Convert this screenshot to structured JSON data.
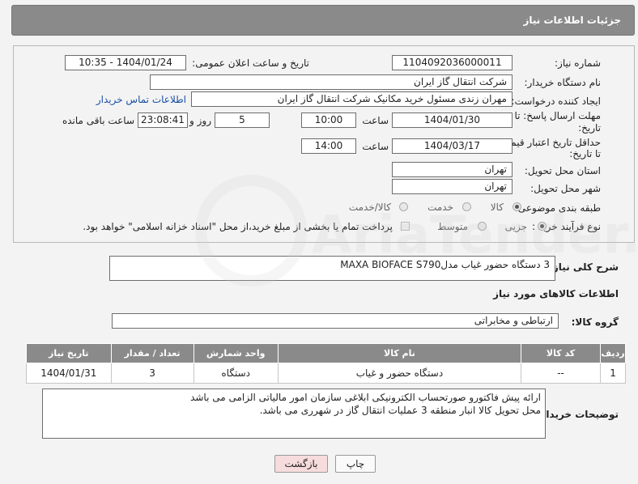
{
  "header": {
    "title": "جزئیات اطلاعات نیاز"
  },
  "form": {
    "need_number_label": "شماره نیاز:",
    "need_number": "1104092036000011",
    "announce_label": "تاریخ و ساعت اعلان عمومی:",
    "announce_value": "1404/01/24 - 10:35",
    "buyer_org_label": "نام دستگاه خریدار:",
    "buyer_org": "شرکت انتقال گاز ایران",
    "creator_label": "ایجاد کننده درخواست:",
    "creator": "مهران زندی مسئول خرید مکانیک شرکت انتقال گاز ایران",
    "buyer_contact_link": "اطلاعات تماس خریدار",
    "reply_deadline_label_1": "مهلت ارسال پاسخ: تا",
    "reply_deadline_label_2": "تاریخ:",
    "reply_date": "1404/01/30",
    "time_label": "ساعت",
    "reply_time": "10:00",
    "days_value": "5",
    "days_label": "روز و",
    "remaining_value": "23:08:41",
    "remaining_label": "ساعت باقی مانده",
    "price_valid_label_1": "حداقل تاریخ اعتبار قیمت:",
    "price_valid_label_2": "تا تاریخ:",
    "price_valid_date": "1404/03/17",
    "price_valid_time": "14:00",
    "province_label": "استان محل تحویل:",
    "province": "تهران",
    "city_label": "شهر محل تحویل:",
    "city": "تهران",
    "category_label": "طبقه بندی موضوعی:",
    "category_options": [
      "کالا",
      "خدمت",
      "کالا/خدمت"
    ],
    "process_label": "نوع فرآیند خرید :",
    "process_options": [
      "جزیی",
      "متوسط"
    ],
    "payment_note": "پرداخت تمام یا بخشی از مبلغ خرید،از محل \"اسناد خزانه اسلامی\" خواهد بود."
  },
  "description": {
    "label": "شرح کلی نیاز:",
    "value": "3 دستگاه حضور غیاب مدلMAXA BIOFACE S790"
  },
  "goods": {
    "section_title": "اطلاعات کالاهای مورد نیاز",
    "group_label": "گروه کالا:",
    "group_value": "ارتباطی و مخابراتی",
    "columns": [
      "ردیف",
      "کد کالا",
      "نام کالا",
      "واحد شمارش",
      "تعداد / مقدار",
      "تاریخ نیاز"
    ],
    "rows": [
      [
        "1",
        "--",
        "دستگاه حضور و غیاب",
        "دستگاه",
        "3",
        "1404/01/31"
      ]
    ]
  },
  "buyer_notes": {
    "label": "توضیحات خریدار:",
    "line1": "ارائه پیش فاکتورو صورتحساب الکترونیکی ابلاغی سازمان امور مالیاتی الزامی می باشد",
    "line2": "محل تحویل کالا انبار منطقه 3 عملیات انتقال گاز در شهرری می باشد."
  },
  "buttons": {
    "print": "چاپ",
    "back": "بازگشت"
  },
  "watermark": {
    "text": "AriaTender.neT"
  }
}
